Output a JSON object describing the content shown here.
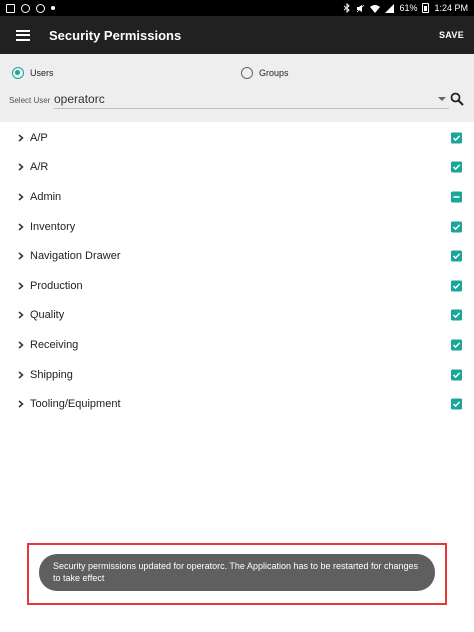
{
  "status_bar": {
    "battery": "61%",
    "time": "1:24 PM",
    "icons": [
      "image-icon",
      "sync-icon",
      "location-icon",
      "dot-icon",
      "bluetooth-icon",
      "mute-icon",
      "wifi-icon",
      "signal-icon",
      "battery-icon"
    ]
  },
  "toolbar": {
    "title": "Security Permissions",
    "save_label": "SAVE",
    "menu_icon": "hamburger-menu-icon"
  },
  "filters": {
    "users_label": "Users",
    "groups_label": "Groups",
    "selected": "Users",
    "select_user_label": "Select User",
    "select_user_value": "operatorc",
    "accent": "#1aa69a"
  },
  "permissions": [
    {
      "label": "A/P",
      "state": "checked"
    },
    {
      "label": "A/R",
      "state": "checked"
    },
    {
      "label": "Admin",
      "state": "indeterminate"
    },
    {
      "label": "Inventory",
      "state": "checked"
    },
    {
      "label": "Navigation Drawer",
      "state": "checked"
    },
    {
      "label": "Production",
      "state": "checked"
    },
    {
      "label": "Quality",
      "state": "checked"
    },
    {
      "label": "Receiving",
      "state": "checked"
    },
    {
      "label": "Shipping",
      "state": "checked"
    },
    {
      "label": "Tooling/Equipment",
      "state": "checked"
    }
  ],
  "toast": {
    "message": "Security permissions updated for operatorc. The Application has to be restarted for changes to take effect"
  }
}
